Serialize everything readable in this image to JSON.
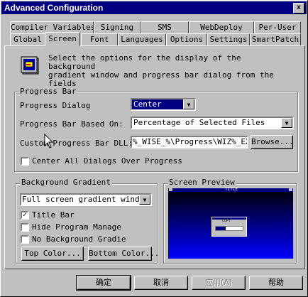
{
  "window": {
    "title": "Advanced Configuration",
    "close_glyph": "x"
  },
  "tabs_row1": [
    {
      "label": "Compiler Variables"
    },
    {
      "label": "Signing"
    },
    {
      "label": "SMS"
    },
    {
      "label": "WebDeploy"
    },
    {
      "label": "Per-User"
    }
  ],
  "tabs_row2": [
    {
      "label": "Global"
    },
    {
      "label": "Screen",
      "active": true
    },
    {
      "label": "Font"
    },
    {
      "label": "Languages"
    },
    {
      "label": "Options"
    },
    {
      "label": "Settings"
    },
    {
      "label": "SmartPatch"
    }
  ],
  "description": "Select the options for the display of the background\ngradient window and progress bar dialog from the fields\nbelow.",
  "progress_bar": {
    "group_label": "Progress Bar",
    "dialog_label": "Progress Dialog",
    "dialog_value": "Center",
    "based_on_label": "Progress Bar Based On:",
    "based_on_value": "Percentage of Selected Files",
    "dll_label": "Custom Progress Bar DLL:",
    "dll_value": "%_WISE_%\\Progress\\WIZ%_EXE_",
    "browse_label": "Browse...",
    "center_all_label": "Center All Dialogs Over Progress",
    "center_all_checked": false
  },
  "background_gradient": {
    "group_label": "Background Gradient",
    "mode_value": "Full screen gradient window",
    "title_bar_label": "Title Bar",
    "title_bar_checked": true,
    "hide_program_label": "Hide Program Manage",
    "hide_program_checked": false,
    "no_background_label": "No Background Gradie",
    "no_background_checked": false,
    "top_color_label": "Top Color...",
    "bottom_color_label": "Bottom Color..."
  },
  "preview": {
    "group_label": "Screen Preview",
    "gradient_top": "#000000",
    "gradient_bottom": "#0000ff",
    "mini_title": "TITLE",
    "mini_dialog_label": "COPY"
  },
  "buttons": {
    "ok": "确定",
    "cancel": "取消",
    "apply": "应用(A)",
    "help": "帮助"
  },
  "colors": {
    "titlebar": "#000080",
    "face": "#c0c0c0",
    "selection": "#000080"
  }
}
